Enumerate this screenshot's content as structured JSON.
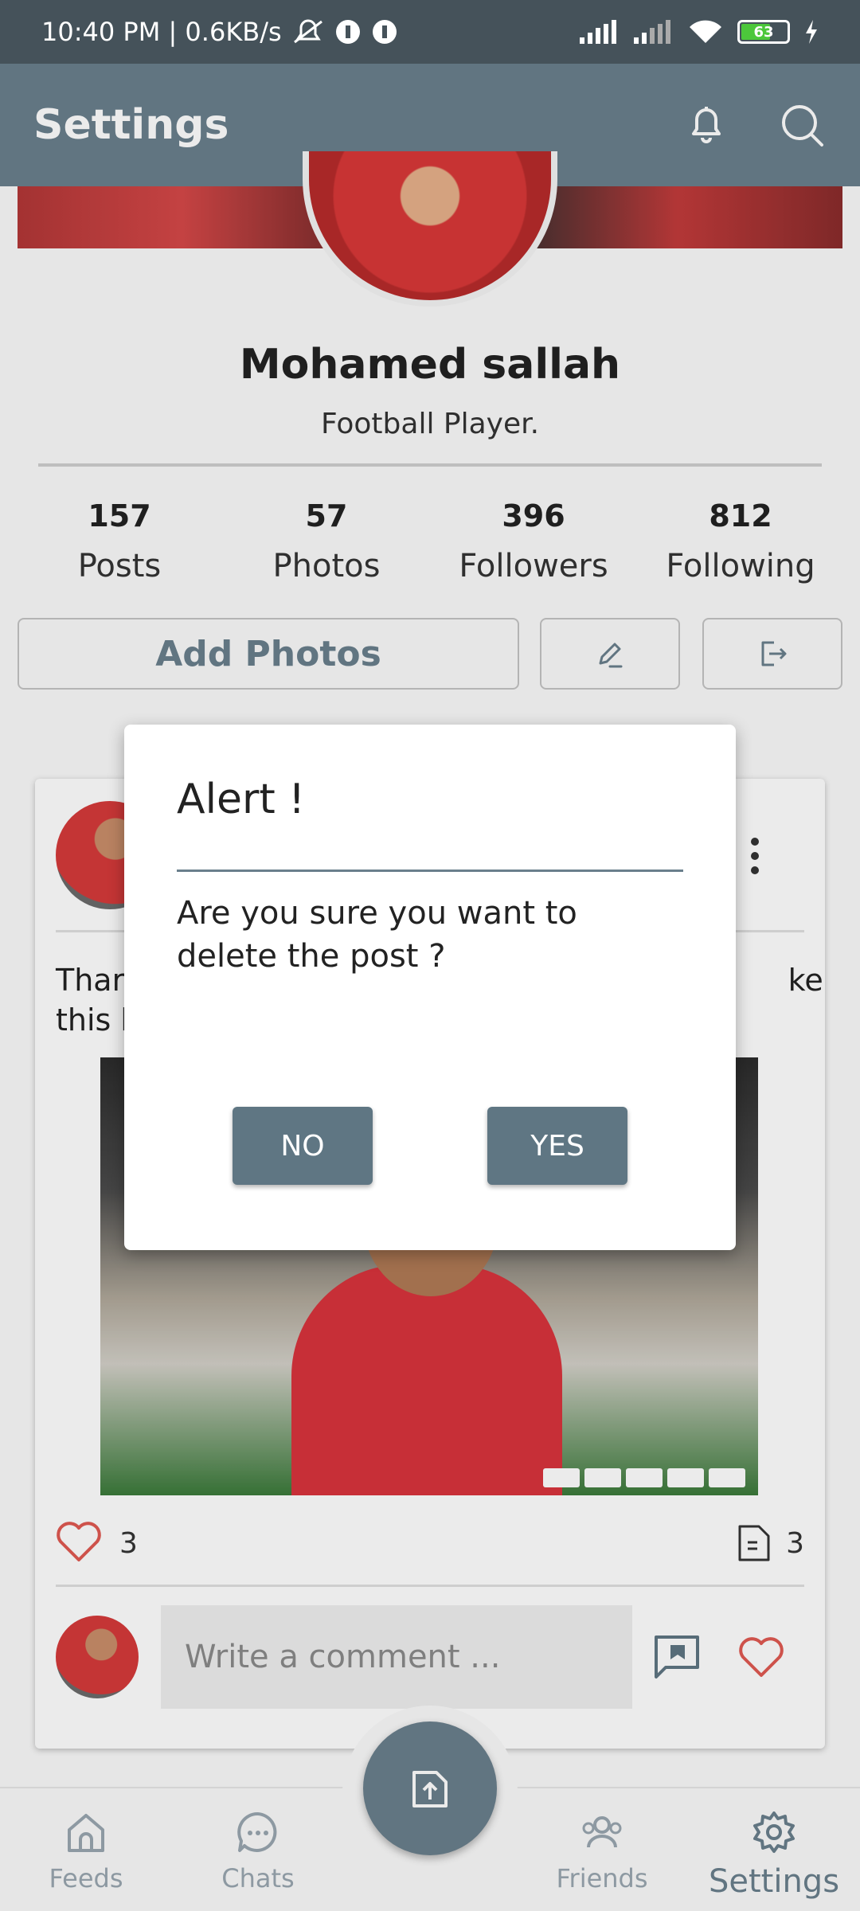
{
  "status_bar": {
    "time_speed": "10:40 PM | 0.6KB/s",
    "battery": "63"
  },
  "app_bar": {
    "title": "Settings",
    "notification_icon": "bell-icon",
    "search_icon": "search-icon"
  },
  "profile": {
    "name": "Mohamed sallah",
    "subtitle": "Football Player.",
    "stats": [
      {
        "value": "157",
        "label": "Posts"
      },
      {
        "value": "57",
        "label": "Photos"
      },
      {
        "value": "396",
        "label": "Followers"
      },
      {
        "value": "812",
        "label": "Following"
      }
    ],
    "add_photos_label": "Add Photos"
  },
  "post": {
    "text_visible": "Thar                                                                     ke\nthis h",
    "likes": "3",
    "comments": "3",
    "comment_placeholder": "Write a comment ..."
  },
  "dialog": {
    "title": "Alert !",
    "message": "Are you sure you want to delete the post ?",
    "no_label": "NO",
    "yes_label": "YES"
  },
  "bottom_nav": {
    "items": [
      {
        "label": "Feeds",
        "icon": "home-icon"
      },
      {
        "label": "Chats",
        "icon": "chat-icon"
      },
      {
        "label": "Friends",
        "icon": "people-icon"
      },
      {
        "label": "Settings",
        "icon": "gear-icon"
      }
    ]
  },
  "colors": {
    "primary": "#6a7f8c",
    "button": "#5f7683",
    "heart": "#e05a52"
  }
}
